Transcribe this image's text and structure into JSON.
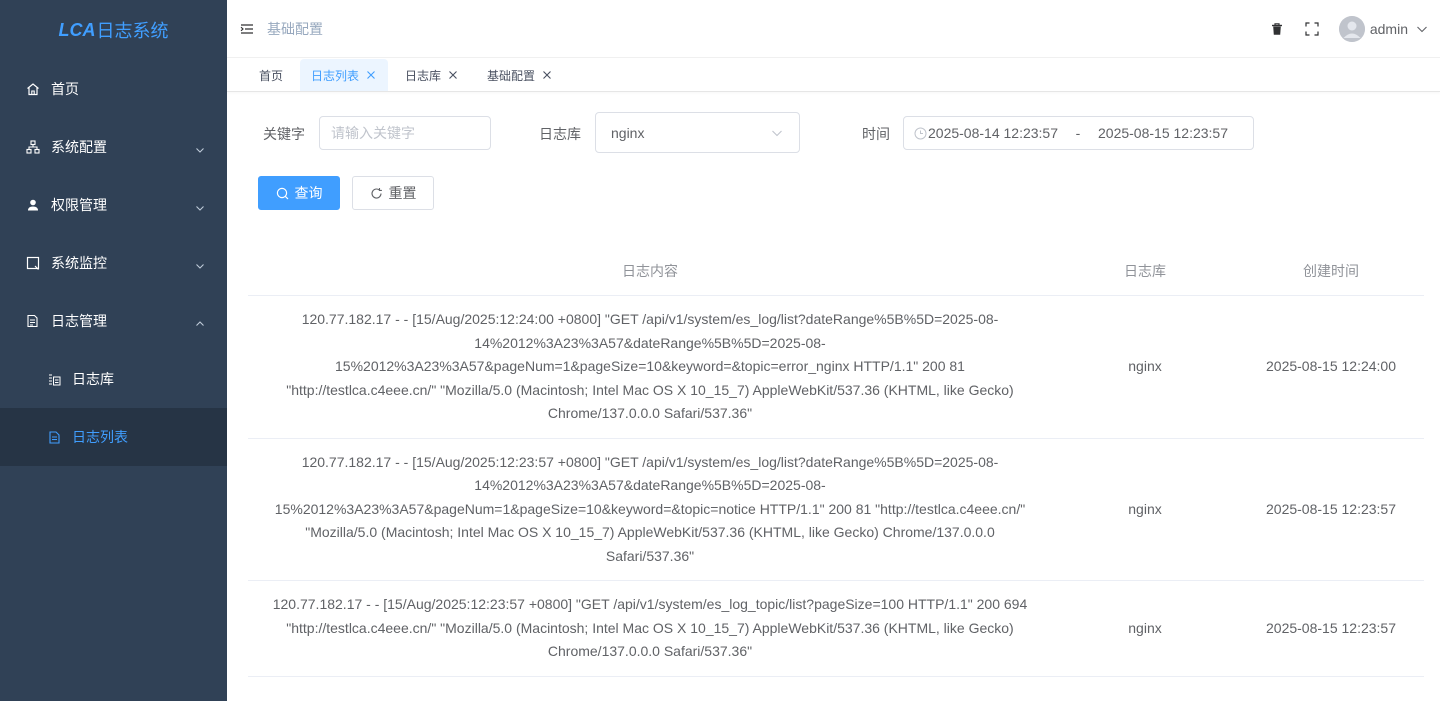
{
  "sidebar": {
    "logo_mark": "LCA",
    "logo_name": "日志系统",
    "menu": [
      {
        "label": "首页",
        "icon": "home-icon"
      },
      {
        "label": "系统配置",
        "icon": "sitemap-icon"
      },
      {
        "label": "权限管理",
        "icon": "user-icon"
      },
      {
        "label": "系统监控",
        "icon": "monitor-icon"
      },
      {
        "label": "日志管理",
        "icon": "log-icon"
      }
    ],
    "submenu": [
      {
        "label": "日志库",
        "icon": "database-icon"
      },
      {
        "label": "日志列表",
        "icon": "document-icon"
      }
    ]
  },
  "navbar": {
    "breadcrumb": "基础配置",
    "username": "admin"
  },
  "tags": [
    {
      "label": "首页",
      "closable": false
    },
    {
      "label": "日志列表",
      "closable": true
    },
    {
      "label": "日志库",
      "closable": true
    },
    {
      "label": "基础配置",
      "closable": true
    }
  ],
  "filters": {
    "keyword_label": "关键字",
    "keyword_placeholder": "请输入关键字",
    "library_label": "日志库",
    "library_value": "nginx",
    "time_label": "时间",
    "time_start": "2025-08-14 12:23:57",
    "time_separator": "-",
    "time_end": "2025-08-15 12:23:57"
  },
  "buttons": {
    "search": "查询",
    "reset": "重置"
  },
  "table": {
    "headers": {
      "content": "日志内容",
      "library": "日志库",
      "created": "创建时间"
    },
    "rows": [
      {
        "content": "120.77.182.17 - - [15/Aug/2025:12:24:00 +0800] \"GET /api/v1/system/es_log/list?dateRange%5B%5D=2025-08-14%2012%3A23%3A57&dateRange%5B%5D=2025-08-15%2012%3A23%3A57&pageNum=1&pageSize=10&keyword=&topic=error_nginx HTTP/1.1\" 200 81 \"http://testlca.c4eee.cn/\" \"Mozilla/5.0 (Macintosh; Intel Mac OS X 10_15_7) AppleWebKit/537.36 (KHTML, like Gecko) Chrome/137.0.0.0 Safari/537.36\"",
        "library": "nginx",
        "created": "2025-08-15 12:24:00"
      },
      {
        "content": "120.77.182.17 - - [15/Aug/2025:12:23:57 +0800] \"GET /api/v1/system/es_log/list?dateRange%5B%5D=2025-08-14%2012%3A23%3A57&dateRange%5B%5D=2025-08-15%2012%3A23%3A57&pageNum=1&pageSize=10&keyword=&topic=notice HTTP/1.1\" 200 81 \"http://testlca.c4eee.cn/\" \"Mozilla/5.0 (Macintosh; Intel Mac OS X 10_15_7) AppleWebKit/537.36 (KHTML, like Gecko) Chrome/137.0.0.0 Safari/537.36\"",
        "library": "nginx",
        "created": "2025-08-15 12:23:57"
      },
      {
        "content": "120.77.182.17 - - [15/Aug/2025:12:23:57 +0800] \"GET /api/v1/system/es_log_topic/list?pageSize=100 HTTP/1.1\" 200 694 \"http://testlca.c4eee.cn/\" \"Mozilla/5.0 (Macintosh; Intel Mac OS X 10_15_7) AppleWebKit/537.36 (KHTML, like Gecko) Chrome/137.0.0.0 Safari/537.36\"",
        "library": "nginx",
        "created": "2025-08-15 12:23:57"
      }
    ]
  },
  "colors": {
    "sidebar_bg": "#304156",
    "sidebar_active_bg": "#263445",
    "primary": "#409eff"
  }
}
